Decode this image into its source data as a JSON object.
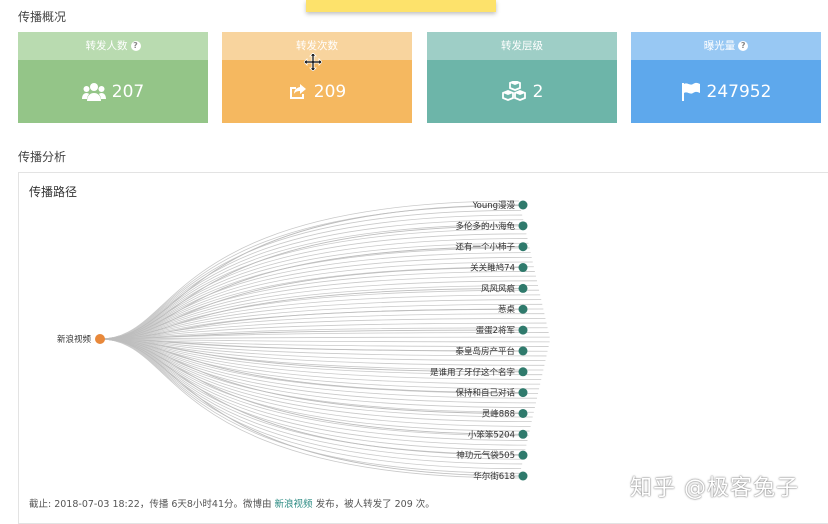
{
  "overview": {
    "title": "传播概况"
  },
  "cards": [
    {
      "label": "转发人数",
      "help": "?",
      "value": "207",
      "icon": "users-icon",
      "head": "#b9dbb0",
      "body": "#94c588"
    },
    {
      "label": "转发次数",
      "help": "",
      "value": "209",
      "icon": "share-icon",
      "head": "#f8d49e",
      "body": "#f5b860"
    },
    {
      "label": "转发层级",
      "help": "",
      "value": "2",
      "icon": "cubes-icon",
      "head": "#9ecec6",
      "body": "#6db5a9"
    },
    {
      "label": "曝光量",
      "help": "?",
      "value": "247952",
      "icon": "flag-icon",
      "head": "#98c8f3",
      "body": "#5ea8ec"
    }
  ],
  "analysis": {
    "title": "传播分析"
  },
  "path": {
    "title": "传播路径",
    "root": "新浪视频",
    "leaves": [
      "Young漫漫",
      "多伦多的小海龟",
      "还有一个小柿子",
      "关关雎鸠74",
      "风风风痕",
      "葱桌",
      "蛋蛋2将军",
      "秦皇岛房产平台",
      "是谁用了牙仔这个名字",
      "保持和自己对话",
      "灵峰888",
      "小笨笨5204",
      "神功元气袋505",
      "华尔街618"
    ],
    "root_color": "#e8883a",
    "leaf_color": "#2f7a6c"
  },
  "footer": {
    "prefix": "截止: 2018-07-03 18:22，传播 6天8小时41分。微博由 ",
    "link": "新浪视频",
    "suffix": " 发布，被人转发了 209 次。"
  },
  "watermark": "知乎 @极客兔子"
}
